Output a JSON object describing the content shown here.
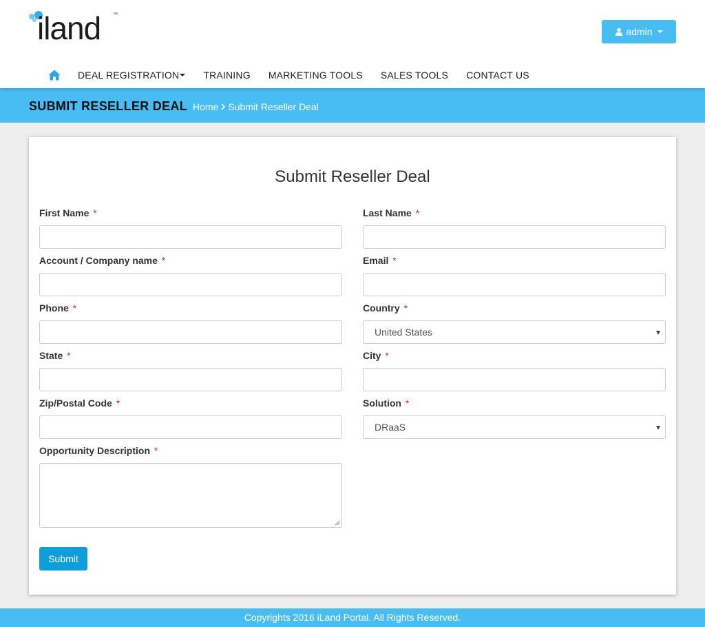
{
  "brand": {
    "logo_text": "iland",
    "trademark": "™"
  },
  "user_menu": {
    "label": "admin",
    "icon": "user-icon"
  },
  "nav": {
    "home_icon": "home-icon",
    "items": [
      {
        "label": "DEAL REGISTRATION",
        "has_dropdown": true
      },
      {
        "label": "TRAINING",
        "has_dropdown": false
      },
      {
        "label": "MARKETING TOOLS",
        "has_dropdown": false
      },
      {
        "label": "SALES TOOLS",
        "has_dropdown": false
      },
      {
        "label": "CONTACT US",
        "has_dropdown": false
      }
    ]
  },
  "banner": {
    "title": "SUBMIT RESELLER DEAL",
    "breadcrumb": {
      "home": "Home",
      "current": "Submit Reseller Deal"
    }
  },
  "form": {
    "title": "Submit Reseller Deal",
    "required_marker": "*",
    "fields": {
      "first_name": {
        "label": "First Name",
        "value": ""
      },
      "last_name": {
        "label": "Last Name",
        "value": ""
      },
      "company": {
        "label": "Account / Company name",
        "value": ""
      },
      "email": {
        "label": "Email",
        "value": ""
      },
      "phone": {
        "label": "Phone",
        "value": ""
      },
      "country": {
        "label": "Country",
        "value": "United States"
      },
      "state": {
        "label": "State",
        "value": ""
      },
      "city": {
        "label": "City",
        "value": ""
      },
      "zip": {
        "label": "Zip/Postal Code",
        "value": ""
      },
      "solution": {
        "label": "Solution",
        "value": "DRaaS"
      },
      "description": {
        "label": "Opportunity Description",
        "value": ""
      }
    },
    "submit_label": "Submit"
  },
  "footer": {
    "text": "Copyrights 2016 iLand Portal. All Rights Reserved."
  },
  "colors": {
    "accent": "#47bdf3",
    "button": "#0f9fd8",
    "required": "#c9302c"
  }
}
